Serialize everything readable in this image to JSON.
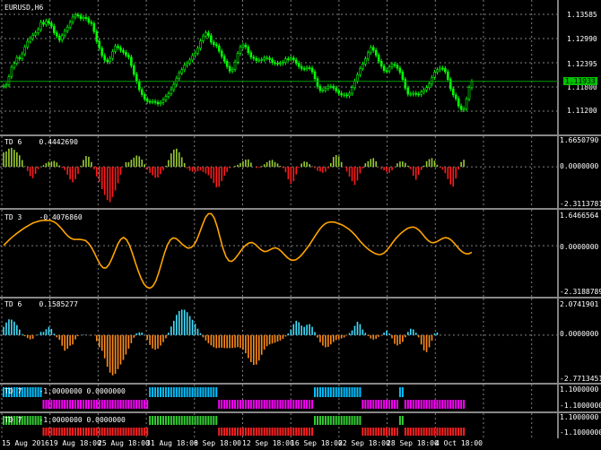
{
  "symbol_label": "EURUSD,H6",
  "colors": {
    "up": "#00ff00",
    "bid": "#00a000",
    "grid": "#808080",
    "osc_up": "#9acd32",
    "osc_down": "#ff1a1a",
    "line": "#ffa500",
    "hist_up": "#40e0ff",
    "hist_down": "#ff8c1a",
    "magenta": "#ff00ff",
    "cyan": "#00bfff",
    "green": "#32cd32",
    "red": "#ff2020"
  },
  "price_pane": {
    "ticks": [
      "1.13585",
      "1.12990",
      "1.12395",
      "1.11800",
      "1.11200"
    ],
    "current": "1.11933"
  },
  "td6a": {
    "name": "TD 6",
    "value": "0.4442690",
    "ticks": [
      "1.6650790",
      "0.0000000",
      "-2.3113781"
    ]
  },
  "td3": {
    "name": "TD 3",
    "value": "-0.4076860",
    "ticks": [
      "1.6466564",
      "0.0000000",
      "-2.3188789"
    ]
  },
  "td6b": {
    "name": "TD 6",
    "value": "0.1585277",
    "ticks": [
      "2.0741901",
      "0.0000000",
      "-2.7713451"
    ]
  },
  "td7a": {
    "name": "TD 7",
    "value": "-1.0000000 0.0000000",
    "ticks": [
      "1.1000000",
      "-1.1000000"
    ]
  },
  "td7b": {
    "name": "TD 7",
    "value": "-1.0000000 0.0000000",
    "ticks": [
      "1.1000000",
      "-1.1000000"
    ]
  },
  "time_axis": [
    "15 Aug 2016",
    "19 Aug 18:00",
    "25 Aug 18:00",
    "31 Aug 18:00",
    "6 Sep 18:00",
    "12 Sep 18:00",
    "16 Sep 18:00",
    "22 Sep 18:00",
    "28 Sep 18:00",
    "4 Oct 18:00"
  ],
  "series": {
    "close": [
      1.1182,
      1.1185,
      1.1205,
      1.1228,
      1.1238,
      1.1252,
      1.1249,
      1.1261,
      1.1278,
      1.1292,
      1.1299,
      1.1307,
      1.1313,
      1.1321,
      1.1339,
      1.1334,
      1.1342,
      1.1337,
      1.1329,
      1.1313,
      1.1305,
      1.1295,
      1.1306,
      1.1318,
      1.1327,
      1.1339,
      1.1352,
      1.1357,
      1.1355,
      1.1348,
      1.1351,
      1.1348,
      1.1339,
      1.1336,
      1.1316,
      1.1292,
      1.1275,
      1.1257,
      1.1246,
      1.1242,
      1.125,
      1.1267,
      1.128,
      1.1276,
      1.127,
      1.1265,
      1.1258,
      1.1253,
      1.1232,
      1.1211,
      1.1193,
      1.1173,
      1.1161,
      1.115,
      1.1144,
      1.1143,
      1.1144,
      1.1142,
      1.1138,
      1.1141,
      1.1148,
      1.1156,
      1.1163,
      1.1173,
      1.1186,
      1.1201,
      1.1214,
      1.1222,
      1.1233,
      1.1238,
      1.1246,
      1.1257,
      1.1263,
      1.1275,
      1.1293,
      1.1305,
      1.1313,
      1.1306,
      1.129,
      1.1284,
      1.1281,
      1.1268,
      1.1255,
      1.1243,
      1.123,
      1.1219,
      1.1223,
      1.1241,
      1.1262,
      1.1278,
      1.1283,
      1.1278,
      1.1264,
      1.1253,
      1.125,
      1.1245,
      1.1246,
      1.1247,
      1.1251,
      1.1251,
      1.1247,
      1.124,
      1.1238,
      1.1237,
      1.1238,
      1.124,
      1.1249,
      1.1248,
      1.1251,
      1.1246,
      1.1238,
      1.123,
      1.1225,
      1.1224,
      1.1227,
      1.1226,
      1.1217,
      1.12,
      1.1181,
      1.1171,
      1.1172,
      1.1176,
      1.1181,
      1.1181,
      1.1177,
      1.117,
      1.1164,
      1.116,
      1.116,
      1.1158,
      1.1164,
      1.1178,
      1.1194,
      1.121,
      1.1225,
      1.1236,
      1.1249,
      1.1264,
      1.1277,
      1.127,
      1.1258,
      1.1243,
      1.1231,
      1.122,
      1.1219,
      1.1229,
      1.1235,
      1.1233,
      1.1226,
      1.1216,
      1.1198,
      1.1177,
      1.1162,
      1.1162,
      1.1164,
      1.1162,
      1.1161,
      1.1167,
      1.1172,
      1.1178,
      1.1188,
      1.1203,
      1.1216,
      1.1222,
      1.1226,
      1.1225,
      1.1217,
      1.1198,
      1.1175,
      1.116,
      1.1151,
      1.1133,
      1.1124,
      1.1126,
      1.115,
      1.1178,
      1.1193
    ],
    "td6a": [
      0.89,
      0.95,
      1.12,
      1.17,
      1.05,
      0.9,
      0.71,
      0.42,
      0.04,
      -0.25,
      -0.57,
      -0.7,
      -0.44,
      -0.14,
      0.02,
      0.11,
      0.24,
      0.32,
      0.33,
      0.37,
      0.27,
      0.09,
      -0.07,
      -0.2,
      -0.48,
      -0.77,
      -0.95,
      -0.76,
      -0.43,
      0.07,
      0.43,
      0.67,
      0.62,
      0.3,
      -0.14,
      -0.59,
      -0.93,
      -1.37,
      -1.73,
      -2.05,
      -2.17,
      -1.86,
      -1.45,
      -1.01,
      -0.49,
      -0.02,
      0.29,
      0.29,
      0.44,
      0.57,
      0.7,
      0.65,
      0.45,
      0.16,
      -0.17,
      -0.37,
      -0.52,
      -0.68,
      -0.65,
      -0.45,
      -0.21,
      0.07,
      0.42,
      0.83,
      1.06,
      1.12,
      0.9,
      0.59,
      0.23,
      -0.09,
      -0.24,
      -0.3,
      -0.32,
      -0.27,
      -0.21,
      -0.31,
      -0.41,
      -0.51,
      -0.72,
      -1.0,
      -1.26,
      -1.23,
      -0.88,
      -0.54,
      -0.31,
      -0.08,
      -0.01,
      0.06,
      0.13,
      0.23,
      0.35,
      0.45,
      0.46,
      0.26,
      0.0,
      -0.07,
      -0.06,
      0.05,
      0.16,
      0.29,
      0.39,
      0.43,
      0.3,
      0.21,
      0.06,
      -0.08,
      -0.33,
      -0.77,
      -1.06,
      -0.88,
      -0.47,
      -0.06,
      0.21,
      0.33,
      0.3,
      0.17,
      0.04,
      -0.07,
      -0.24,
      -0.29,
      -0.36,
      -0.3,
      -0.11,
      0.23,
      0.62,
      0.73,
      0.65,
      0.3,
      -0.02,
      -0.29,
      -0.6,
      -0.88,
      -1.12,
      -0.84,
      -0.41,
      -0.1,
      0.22,
      0.35,
      0.49,
      0.54,
      0.34,
      0.0,
      -0.14,
      -0.21,
      -0.31,
      -0.37,
      -0.21,
      0.01,
      0.22,
      0.33,
      0.34,
      0.25,
      0.07,
      -0.14,
      -0.55,
      -0.79,
      -0.49,
      -0.2,
      0.08,
      0.35,
      0.48,
      0.54,
      0.38,
      0.13,
      -0.04,
      -0.17,
      -0.39,
      -0.75,
      -1.08,
      -1.22,
      -0.72,
      -0.16,
      0.3,
      0.44
    ],
    "td3": [
      0.02,
      0.16,
      0.31,
      0.45,
      0.57,
      0.68,
      0.79,
      0.89,
      0.98,
      1.07,
      1.15,
      1.2,
      1.25,
      1.28,
      1.29,
      1.29,
      1.28,
      1.23,
      1.14,
      1.0,
      0.83,
      0.65,
      0.49,
      0.38,
      0.32,
      0.32,
      0.32,
      0.3,
      0.26,
      0.13,
      -0.08,
      -0.35,
      -0.67,
      -0.96,
      -1.12,
      -1.13,
      -0.96,
      -0.66,
      -0.29,
      0.07,
      0.32,
      0.42,
      0.31,
      0.03,
      -0.38,
      -0.84,
      -1.28,
      -1.66,
      -1.95,
      -2.11,
      -2.16,
      -2.06,
      -1.8,
      -1.38,
      -0.87,
      -0.37,
      0.04,
      0.3,
      0.4,
      0.36,
      0.23,
      0.08,
      -0.04,
      -0.12,
      -0.1,
      0.03,
      0.29,
      0.67,
      1.08,
      1.44,
      1.63,
      1.63,
      1.41,
      0.96,
      0.4,
      -0.15,
      -0.56,
      -0.77,
      -0.79,
      -0.67,
      -0.48,
      -0.27,
      -0.08,
      0.06,
      0.15,
      0.16,
      0.07,
      -0.07,
      -0.21,
      -0.29,
      -0.28,
      -0.21,
      -0.13,
      -0.11,
      -0.17,
      -0.3,
      -0.46,
      -0.61,
      -0.71,
      -0.74,
      -0.7,
      -0.59,
      -0.44,
      -0.26,
      -0.06,
      0.16,
      0.39,
      0.62,
      0.84,
      1.01,
      1.13,
      1.19,
      1.21,
      1.2,
      1.16,
      1.1,
      1.03,
      0.94,
      0.84,
      0.71,
      0.56,
      0.38,
      0.2,
      0.04,
      -0.1,
      -0.22,
      -0.32,
      -0.4,
      -0.45,
      -0.44,
      -0.37,
      -0.22,
      -0.03,
      0.17,
      0.36,
      0.52,
      0.66,
      0.78,
      0.88,
      0.93,
      0.95,
      0.9,
      0.78,
      0.62,
      0.43,
      0.27,
      0.17,
      0.15,
      0.2,
      0.29,
      0.37,
      0.41,
      0.38,
      0.28,
      0.13,
      -0.05,
      -0.22,
      -0.34,
      -0.41,
      -0.41,
      -0.33
    ],
    "td6b": [
      0.52,
      0.79,
      0.99,
      0.97,
      0.85,
      0.63,
      0.35,
      0.05,
      -0.07,
      -0.19,
      -0.27,
      -0.23,
      -0.02,
      0.03,
      0.2,
      0.2,
      0.37,
      0.52,
      0.39,
      0.09,
      -0.14,
      -0.3,
      -0.67,
      -0.98,
      -0.86,
      -0.67,
      -0.59,
      -0.27,
      -0.06,
      0.0,
      0.03,
      0.02,
      -0.02,
      -0.03,
      0.0,
      -0.38,
      -0.77,
      -0.99,
      -1.46,
      -1.99,
      -2.36,
      -2.53,
      -2.43,
      -2.14,
      -1.85,
      -1.56,
      -1.22,
      -0.85,
      -0.51,
      -0.17,
      0.11,
      0.17,
      0.16,
      0.01,
      -0.29,
      -0.62,
      -0.84,
      -0.92,
      -0.85,
      -0.66,
      -0.44,
      -0.2,
      0.15,
      0.54,
      0.9,
      1.27,
      1.51,
      1.6,
      1.59,
      1.44,
      1.2,
      0.96,
      0.71,
      0.4,
      0.12,
      -0.14,
      -0.34,
      -0.51,
      -0.65,
      -0.76,
      -0.82,
      -0.8,
      -0.79,
      -0.81,
      -0.82,
      -0.82,
      -0.81,
      -0.79,
      -0.76,
      -0.81,
      -0.92,
      -1.14,
      -1.45,
      -1.7,
      -1.87,
      -1.85,
      -1.6,
      -1.24,
      -0.91,
      -0.7,
      -0.59,
      -0.53,
      -0.48,
      -0.41,
      -0.34,
      -0.24,
      -0.09,
      0.1,
      0.36,
      0.69,
      0.9,
      0.81,
      0.6,
      0.52,
      0.65,
      0.69,
      0.52,
      0.19,
      -0.16,
      -0.45,
      -0.66,
      -0.77,
      -0.74,
      -0.59,
      -0.43,
      -0.31,
      -0.24,
      -0.21,
      -0.15,
      -0.02,
      0.13,
      0.3,
      0.58,
      0.84,
      0.69,
      0.35,
      0.14,
      -0.06,
      -0.21,
      -0.28,
      -0.23,
      -0.11,
      -0.03,
      0.16,
      0.28,
      0.1,
      -0.2,
      -0.55,
      -0.65,
      -0.57,
      -0.43,
      -0.14,
      0.2,
      0.4,
      0.36,
      0.15,
      -0.14,
      -0.59,
      -0.96,
      -1.07,
      -0.77,
      -0.35,
      0.11,
      0.16
    ],
    "td7a": [
      1,
      1,
      1,
      1,
      1,
      1,
      1,
      1,
      1,
      1,
      1,
      1,
      1,
      1,
      1,
      -1,
      -1,
      -1,
      -1,
      -1,
      -1,
      -1,
      -1,
      -1,
      -1,
      -1,
      -1,
      -1,
      -1,
      -1,
      -1,
      -1,
      -1,
      -1,
      -1,
      -1,
      -1,
      -1,
      -1,
      -1,
      -1,
      -1,
      -1,
      -1,
      -1,
      -1,
      -1,
      -1,
      -1,
      -1,
      -1,
      -1,
      -1,
      -1,
      -1,
      1,
      1,
      1,
      1,
      1,
      1,
      1,
      1,
      1,
      1,
      1,
      1,
      1,
      1,
      1,
      1,
      1,
      1,
      1,
      1,
      1,
      1,
      1,
      1,
      1,
      1,
      -1,
      -1,
      -1,
      -1,
      -1,
      -1,
      -1,
      -1,
      -1,
      -1,
      -1,
      -1,
      -1,
      -1,
      -1,
      -1,
      -1,
      -1,
      -1,
      -1,
      -1,
      -1,
      -1,
      -1,
      -1,
      -1,
      -1,
      -1,
      -1,
      -1,
      -1,
      -1,
      -1,
      -1,
      -1,
      -1,
      1,
      1,
      1,
      1,
      1,
      1,
      1,
      1,
      1,
      1,
      1,
      1,
      1,
      1,
      1,
      1,
      1,
      1,
      -1,
      -1,
      -1,
      -1,
      -1,
      -1,
      -1,
      -1,
      -1,
      -1,
      -1,
      -1,
      -1,
      -1,
      1,
      1,
      -1,
      -1,
      -1,
      -1,
      -1,
      -1,
      -1,
      -1,
      -1,
      -1,
      -1,
      -1,
      -1,
      -1,
      -1,
      -1,
      -1,
      -1,
      -1,
      -1,
      -1,
      -1,
      -1
    ],
    "td7b": [
      1,
      1,
      1,
      1,
      1,
      1,
      1,
      1,
      1,
      1,
      1,
      1,
      1,
      1,
      1,
      -1,
      -1,
      -1,
      -1,
      -1,
      -1,
      -1,
      -1,
      -1,
      -1,
      -1,
      -1,
      -1,
      -1,
      -1,
      -1,
      -1,
      -1,
      -1,
      -1,
      -1,
      -1,
      -1,
      -1,
      -1,
      -1,
      -1,
      -1,
      -1,
      -1,
      -1,
      -1,
      -1,
      -1,
      -1,
      -1,
      -1,
      -1,
      -1,
      -1,
      1,
      1,
      1,
      1,
      1,
      1,
      1,
      1,
      1,
      1,
      1,
      1,
      1,
      1,
      1,
      1,
      1,
      1,
      1,
      1,
      1,
      1,
      1,
      1,
      1,
      1,
      -1,
      -1,
      -1,
      -1,
      -1,
      -1,
      -1,
      -1,
      -1,
      -1,
      -1,
      -1,
      -1,
      -1,
      -1,
      -1,
      -1,
      -1,
      -1,
      -1,
      -1,
      -1,
      -1,
      -1,
      -1,
      -1,
      -1,
      -1,
      -1,
      -1,
      -1,
      -1,
      -1,
      -1,
      -1,
      -1,
      1,
      1,
      1,
      1,
      1,
      1,
      1,
      1,
      1,
      1,
      1,
      1,
      1,
      1,
      1,
      1,
      1,
      1,
      -1,
      -1,
      -1,
      -1,
      -1,
      -1,
      -1,
      -1,
      -1,
      -1,
      -1,
      -1,
      -1,
      -1,
      1,
      1,
      -1,
      -1,
      -1,
      -1,
      -1,
      -1,
      -1,
      -1,
      -1,
      -1,
      -1,
      -1,
      -1,
      -1,
      -1,
      -1,
      -1,
      -1,
      -1,
      -1,
      -1,
      -1,
      -1
    ]
  }
}
